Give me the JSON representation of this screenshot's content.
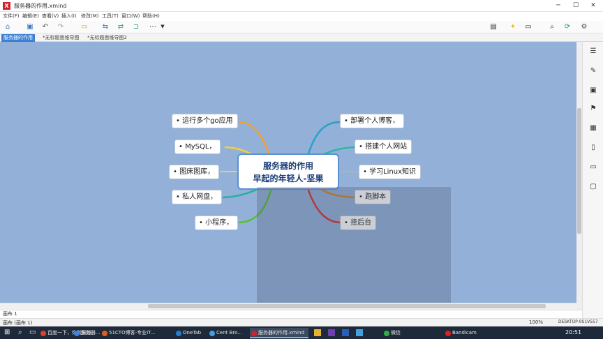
{
  "window": {
    "title": "服务器的作用.xmind",
    "app_icon": "xmind-icon",
    "controls": [
      "─",
      "☐",
      "✕"
    ]
  },
  "menu": [
    "文件(F)",
    "编辑(E)",
    "查看(V)",
    "插入(I)",
    "修改(M)",
    "工具(T)",
    "窗口(W)",
    "帮助(H)"
  ],
  "toolbar": {
    "icons": [
      "home-icon",
      "save-icon",
      "undo-icon",
      "redo-icon",
      "topic-icon",
      "subtopic-icon",
      "relationship-icon",
      "boundary-icon",
      "more-icon",
      "dropdown-icon",
      "style-icon",
      "idea-icon",
      "presentation-icon",
      "search-icon",
      "share-icon",
      "settings-icon"
    ]
  },
  "tabs": [
    {
      "label": "服务器的作用",
      "active": true
    },
    {
      "label": "*无标题思维导图",
      "active": false
    },
    {
      "label": "*无标题思维导图2",
      "active": false
    }
  ],
  "mindmap": {
    "center": {
      "line1": "服务器的作用",
      "line2": "早起的年轻人-坚果"
    },
    "left": [
      "运行多个go应用",
      "MySQL，",
      "图床图库，",
      "私人网盘，",
      "小程序，"
    ],
    "right": [
      "部署个人博客，",
      "搭建个人网站",
      "学习Linux知识",
      "跑脚本",
      "挂后台"
    ],
    "branch_colors": {
      "left": [
        "#f0a030",
        "#f0d040",
        "#58b848",
        "#28b0a0",
        "#58c030"
      ],
      "right": [
        "#2aa0c8",
        "#28b8a8",
        "#c8c040",
        "#e08020",
        "#e03030"
      ]
    }
  },
  "status": {
    "sheet_tab": "画布 1",
    "left_text": "画布 (画布 1)",
    "zoom": "100%",
    "hostname": "DESKTOP-0S1V557"
  },
  "taskbar": {
    "items": [
      {
        "label": "百度一下，你就知道",
        "color": "#e04030"
      },
      {
        "label": "服务器...",
        "color": "#4080e0"
      },
      {
        "label": "51CTO博客-专业IT...",
        "color": "#e06020"
      },
      {
        "label": "OneTab",
        "color": "#2080d0"
      },
      {
        "label": "Cent Bro...",
        "color": "#40a0e0"
      },
      {
        "label": "服务器的作用.xmind",
        "color": "#d02030"
      },
      {
        "label": "微信",
        "color": "#30b040"
      },
      {
        "label": "Bandicam",
        "color": "#e02020"
      }
    ],
    "clock": "20:51"
  }
}
